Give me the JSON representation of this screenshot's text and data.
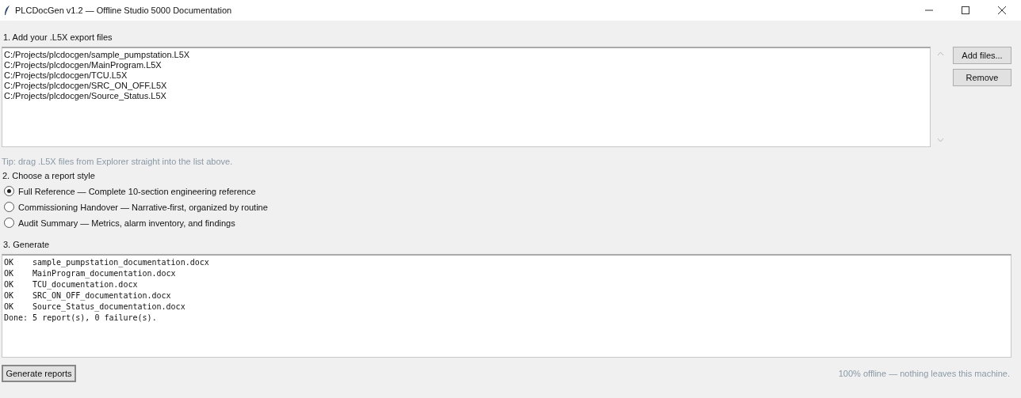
{
  "window": {
    "title": "PLCDocGen v1.2 — Offline Studio 5000 Documentation"
  },
  "files_section": {
    "label": "1. Add your .L5X export files",
    "files": [
      "C:/Projects/plcdocgen/sample_pumpstation.L5X",
      "C:/Projects/plcdocgen/MainProgram.L5X",
      "C:/Projects/plcdocgen/TCU.L5X",
      "C:/Projects/plcdocgen/SRC_ON_OFF.L5X",
      "C:/Projects/plcdocgen/Source_Status.L5X"
    ],
    "buttons": [
      "Add files...",
      "Remove"
    ],
    "tip": "Tip: drag .L5X files from Explorer straight into the list above."
  },
  "style_section": {
    "label": "2. Choose a report style",
    "options": [
      {
        "label": "Full Reference — Complete 10-section engineering reference",
        "selected": true
      },
      {
        "label": "Commissioning Handover — Narrative-first, organized by routine",
        "selected": false
      },
      {
        "label": "Audit Summary — Metrics, alarm inventory, and findings",
        "selected": false
      }
    ]
  },
  "generate_section": {
    "label": "3. Generate",
    "log": [
      {
        "kind": "result",
        "status": "OK",
        "file": "sample_pumpstation_documentation.docx"
      },
      {
        "kind": "result",
        "status": "OK",
        "file": "MainProgram_documentation.docx"
      },
      {
        "kind": "result",
        "status": "OK",
        "file": "TCU_documentation.docx"
      },
      {
        "kind": "result",
        "status": "OK",
        "file": "SRC_ON_OFF_documentation.docx"
      },
      {
        "kind": "result",
        "status": "OK",
        "file": "Source_Status_documentation.docx"
      },
      {
        "kind": "summary",
        "text": "Done: 5 report(s), 0 failure(s)."
      }
    ]
  },
  "footer": {
    "button": "Generate reports",
    "note": "100% offline — nothing leaves this machine."
  }
}
